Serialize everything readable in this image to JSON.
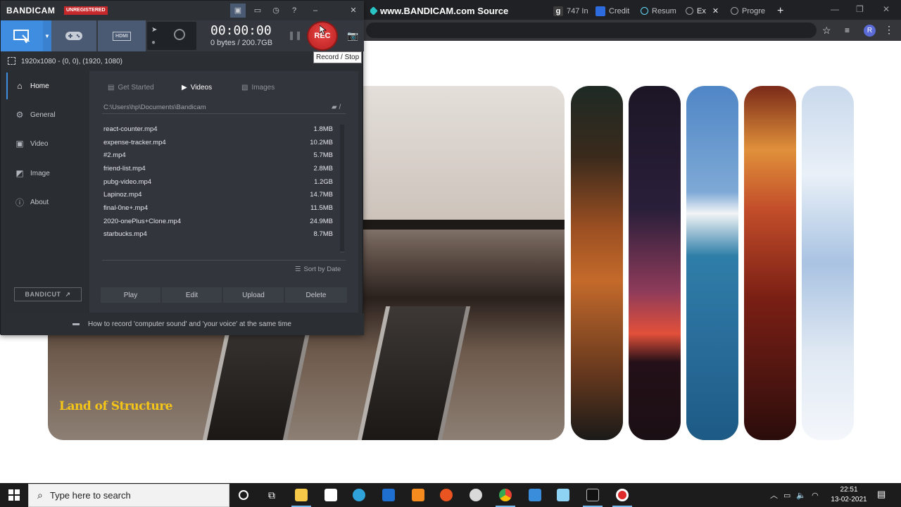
{
  "browser": {
    "tabs": [
      {
        "label": "www.BANDICAM.com Source",
        "color": "#29c5c5"
      },
      {
        "label": "747 In",
        "color": "#ffffff",
        "badge": "g"
      },
      {
        "label": "Credit",
        "color": "#2d6cdf"
      },
      {
        "label": "Resum",
        "color": "#61dafb"
      },
      {
        "label": "Ex",
        "color": "#9aa0a6"
      },
      {
        "label": "Progre",
        "color": "#9aa0a6"
      }
    ],
    "new_tab": "+",
    "close_tab": "✕",
    "profile_initial": "R"
  },
  "webpage": {
    "hero_caption": "Land of Structure"
  },
  "bandicam": {
    "logo": "BANDICAM",
    "unregistered": "UNREGISTERED",
    "timer": "00:00:00",
    "bytes": "0 bytes / 200.7GB",
    "rec_label": "REC",
    "tooltip": "Record / Stop",
    "hdmi_label": "HDMI",
    "region": "1920x1080 - (0, 0), (1920, 1080)",
    "sidebar": [
      {
        "label": "Home",
        "icon": "home-icon",
        "glyph": "⌂",
        "active": true
      },
      {
        "label": "General",
        "icon": "gear-icon",
        "glyph": "⚙",
        "active": false
      },
      {
        "label": "Video",
        "icon": "video-icon",
        "glyph": "▣",
        "active": false
      },
      {
        "label": "Image",
        "icon": "image-icon",
        "glyph": "◩",
        "active": false
      },
      {
        "label": "About",
        "icon": "info-icon",
        "glyph": "ⓘ",
        "active": false
      }
    ],
    "bandicut_label": "BANDICUT",
    "content_tabs": [
      {
        "label": "Get Started",
        "active": false
      },
      {
        "label": "Videos",
        "active": true
      },
      {
        "label": "Images",
        "active": false
      }
    ],
    "path": "C:\\Users\\hp\\Documents\\Bandicam",
    "files": [
      {
        "name": "react-counter.mp4",
        "size": "1.8MB"
      },
      {
        "name": "expense-tracker.mp4",
        "size": "10.2MB"
      },
      {
        "name": "#2.mp4",
        "size": "5.7MB"
      },
      {
        "name": "friend-list.mp4",
        "size": "2.8MB"
      },
      {
        "name": "pubg-video.mp4",
        "size": "1.2GB"
      },
      {
        "name": "Lapinoz.mp4",
        "size": "14.7MB"
      },
      {
        "name": "final-0ne+.mp4",
        "size": "11.5MB"
      },
      {
        "name": "2020-onePlus+Clone.mp4",
        "size": "24.9MB"
      },
      {
        "name": "starbucks.mp4",
        "size": "8.7MB"
      }
    ],
    "sort_label": "Sort by Date",
    "actions": [
      "Play",
      "Edit",
      "Upload",
      "Delete"
    ],
    "footer_tip": "How to record 'computer sound' and 'your voice' at the same time"
  },
  "taskbar": {
    "search_placeholder": "Type here to search",
    "time": "22:51",
    "date": "13-02-2021",
    "apps": [
      {
        "name": "cortana",
        "color": "#ffffff"
      },
      {
        "name": "task-view",
        "color": "#ffffff"
      },
      {
        "name": "file-explorer",
        "color": "#f7c948"
      },
      {
        "name": "store",
        "color": "#ffffff"
      },
      {
        "name": "edge",
        "color": "#2fa3d9"
      },
      {
        "name": "devhub",
        "color": "#1f6fd1"
      },
      {
        "name": "sublime",
        "color": "#f58b1f"
      },
      {
        "name": "ubuntu",
        "color": "#e95420"
      },
      {
        "name": "obs",
        "color": "#d9d9d9"
      },
      {
        "name": "chrome",
        "color": "#4caf50"
      },
      {
        "name": "photos",
        "color": "#3a8ddb"
      },
      {
        "name": "notepad",
        "color": "#8fd3f4"
      },
      {
        "name": "terminal",
        "color": "#111111"
      },
      {
        "name": "bandicam",
        "color": "#e02b2b"
      }
    ]
  }
}
